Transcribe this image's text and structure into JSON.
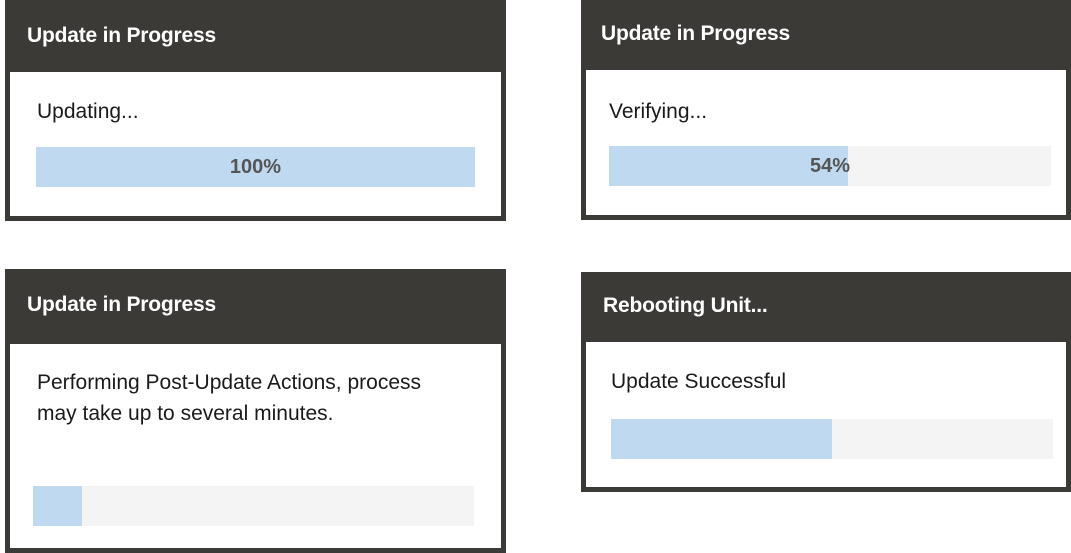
{
  "dialogs": [
    {
      "title": "Update in Progress",
      "message": "Updating...",
      "progress_percent": 100,
      "progress_label": "100%"
    },
    {
      "title": "Update in Progress",
      "message": "Verifying...",
      "progress_percent": 54,
      "progress_label": "54%"
    },
    {
      "title": "Update in Progress",
      "message": "Performing Post-Update Actions, process may take up to several minutes.",
      "progress_percent": 11
    },
    {
      "title": "Rebooting Unit...",
      "message": "Update Successful",
      "progress_percent": 50
    }
  ],
  "colors": {
    "header_background": "#3c3a36",
    "progress_fill": "#bfdaf0",
    "progress_track": "#f4f4f4",
    "progress_text": "#555555"
  }
}
